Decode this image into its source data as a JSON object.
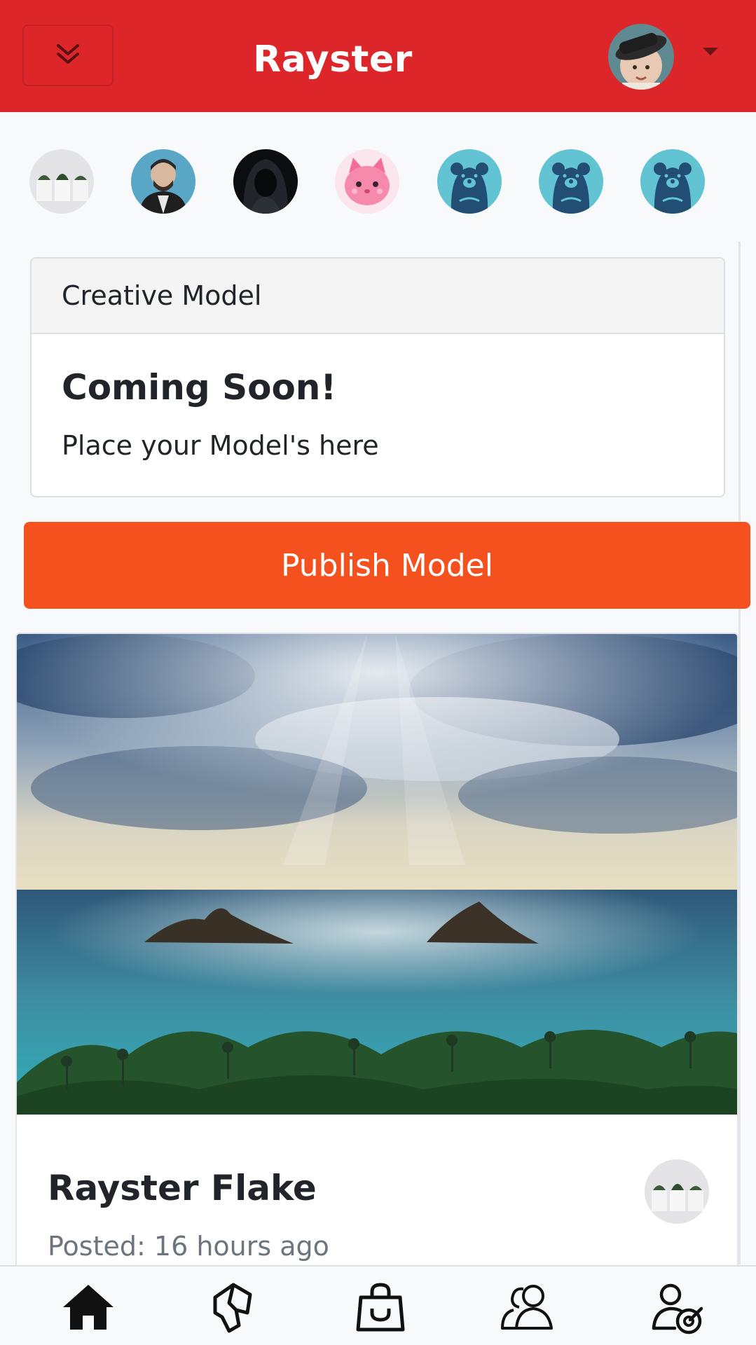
{
  "header": {
    "brand": "Rayster",
    "menu_icon": "chevron-double-down-icon",
    "user_menu_icon": "caret-down-icon",
    "background_color": "#dc262a"
  },
  "stories": [
    {
      "name": "story-plants-avatar"
    },
    {
      "name": "story-man-avatar"
    },
    {
      "name": "story-hooded-avatar"
    },
    {
      "name": "story-pink-cat-avatar"
    },
    {
      "name": "story-bear-avatar"
    },
    {
      "name": "story-bear-avatar"
    },
    {
      "name": "story-bear-avatar"
    }
  ],
  "model_card": {
    "header": "Creative Model",
    "title": "Coming Soon!",
    "text": "Place your Model's here"
  },
  "publish_button": {
    "label": "Publish Model",
    "color": "#f4511e"
  },
  "post": {
    "author": "Rayster Flake",
    "posted": "Posted: 16 hours ago"
  },
  "bottom_nav": [
    {
      "icon": "home-icon"
    },
    {
      "icon": "map-icon"
    },
    {
      "icon": "shopping-bag-icon"
    },
    {
      "icon": "users-icon"
    },
    {
      "icon": "user-target-icon"
    }
  ]
}
